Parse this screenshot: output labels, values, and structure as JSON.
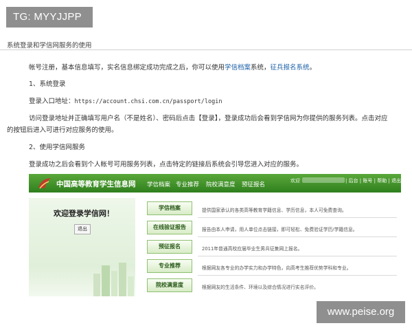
{
  "badge": "TG: MYYJJPP",
  "section_title": "系统登录和学信网服务的使用",
  "content": {
    "p1_prefix": "帐号注册，基本信息填写，实名信息绑定成功完成之后，你可以使用",
    "p1_link1": "学信档案",
    "p1_mid": "系统，",
    "p1_link2": "征兵报名系统",
    "p1_suffix": "。",
    "h1": "1、系统登录",
    "login_label": "登录入口地址：",
    "login_url": "https://account.chsi.com.cn/passport/login",
    "p2_line1": "访问登录地址并正确填写用户名（不是姓名）、密码后点击【登录】，登录成功后会看到学信网为你提供的服务列表。点击对应",
    "p2_line2": "的按钮后进入可进行对应服务的使用。",
    "h2": "2、使用学信网服务",
    "p3": "登录成功之后会看到个人帐号可用服务列表，点击特定的链接后系统会引导您进入对应的服务。"
  },
  "portal": {
    "site_name": "中国高等教育学生信息网",
    "nav": [
      "学信档案",
      "专业推荐",
      "院校满意度",
      "预征报名"
    ],
    "welcome": "欢迎",
    "top_links": "| 后台 | 账号 | 帮助 | 退出",
    "welcome_title": "欢迎登录学信网！",
    "logout_label": "退出",
    "services": [
      {
        "label": "学信档案",
        "desc": "提供国家承认的各类高等教育学籍信息、学历信息，本人可免费查询。"
      },
      {
        "label": "在线验证报告",
        "desc": "报告由本人申请，用人单位点击链接，即可轻松、免费验证学历/学籍信息。"
      },
      {
        "label": "预征报名",
        "desc": "2011年普通高校应届毕业生男兵征集网上报名。"
      },
      {
        "label": "专业推荐",
        "desc": "根据网友各专业的办学实力和办学特色，向高考生推荐优势学科和专业。"
      },
      {
        "label": "院校满意度",
        "desc": "根据网友的生活条件、环境以及综合情况进行实名评价。"
      }
    ]
  },
  "watermark": "www.peise.org",
  "colors": {
    "nav_green": "#3a8f26",
    "link_blue": "#1a5fa8",
    "button_border": "#8fc070"
  }
}
